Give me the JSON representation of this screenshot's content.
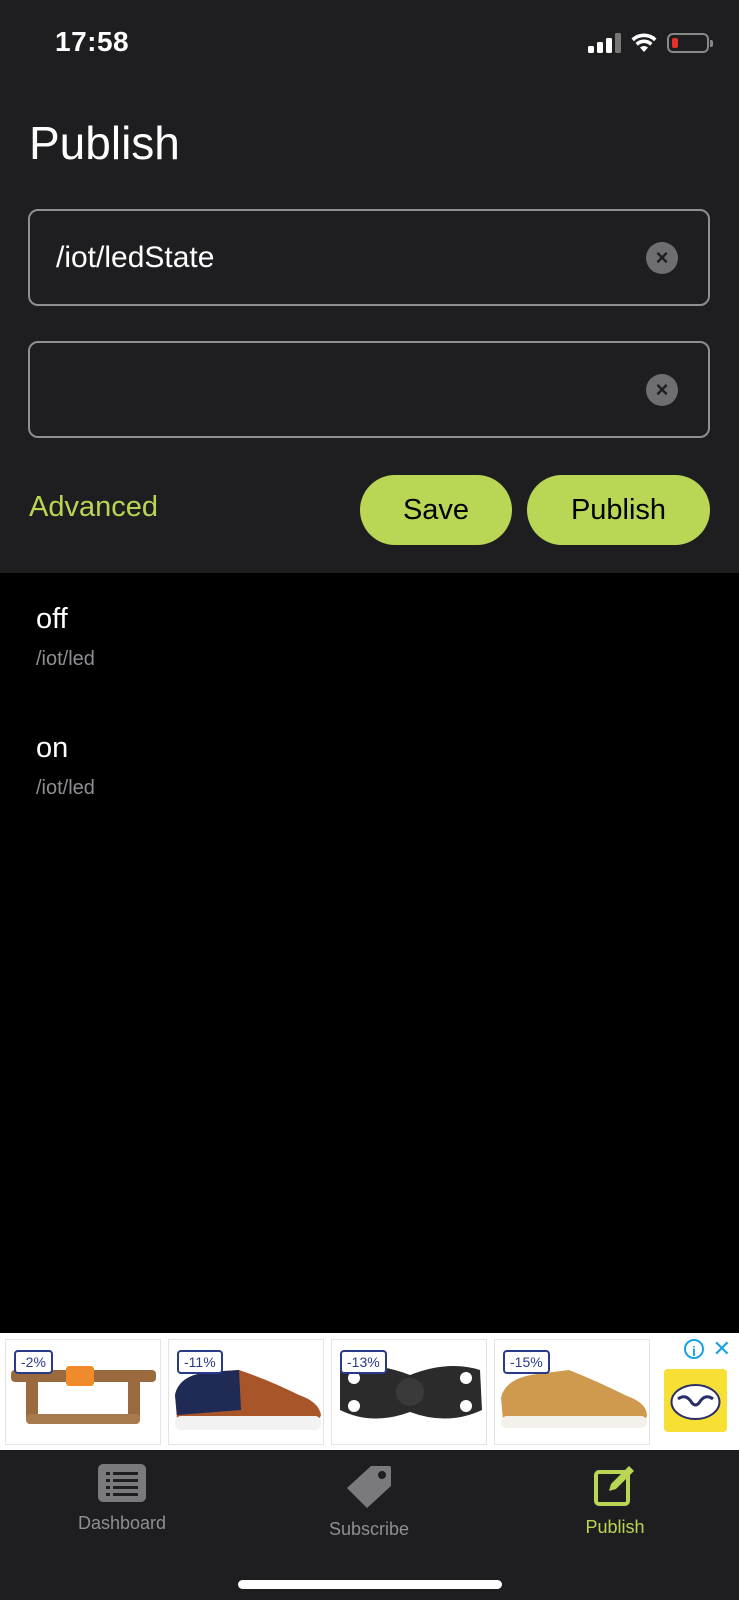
{
  "status_bar": {
    "time": "17:58"
  },
  "header": {
    "title": "Publish"
  },
  "form": {
    "topic_value": "/iot/ledState",
    "payload_value": "",
    "advanced_label": "Advanced",
    "save_label": "Save",
    "publish_label": "Publish"
  },
  "saved_messages": [
    {
      "payload": "off",
      "topic": "/iot/led"
    },
    {
      "payload": "on",
      "topic": "/iot/led"
    }
  ],
  "ad_banner": {
    "tiles": [
      {
        "discount": "-2%"
      },
      {
        "discount": "-11%"
      },
      {
        "discount": "-13%"
      },
      {
        "discount": "-15%"
      }
    ],
    "info_icon": "info-icon",
    "close_icon": "close-icon"
  },
  "tab_bar": {
    "tabs": [
      {
        "label": "Dashboard",
        "icon": "list-icon"
      },
      {
        "label": "Subscribe",
        "icon": "tag-icon"
      },
      {
        "label": "Publish",
        "icon": "edit-icon"
      }
    ],
    "active_tab": "Publish"
  },
  "colors": {
    "accent": "#b9d655",
    "panel_bg": "#1e1e20",
    "list_bg": "#000000",
    "secondary_text": "#8e8e93"
  }
}
